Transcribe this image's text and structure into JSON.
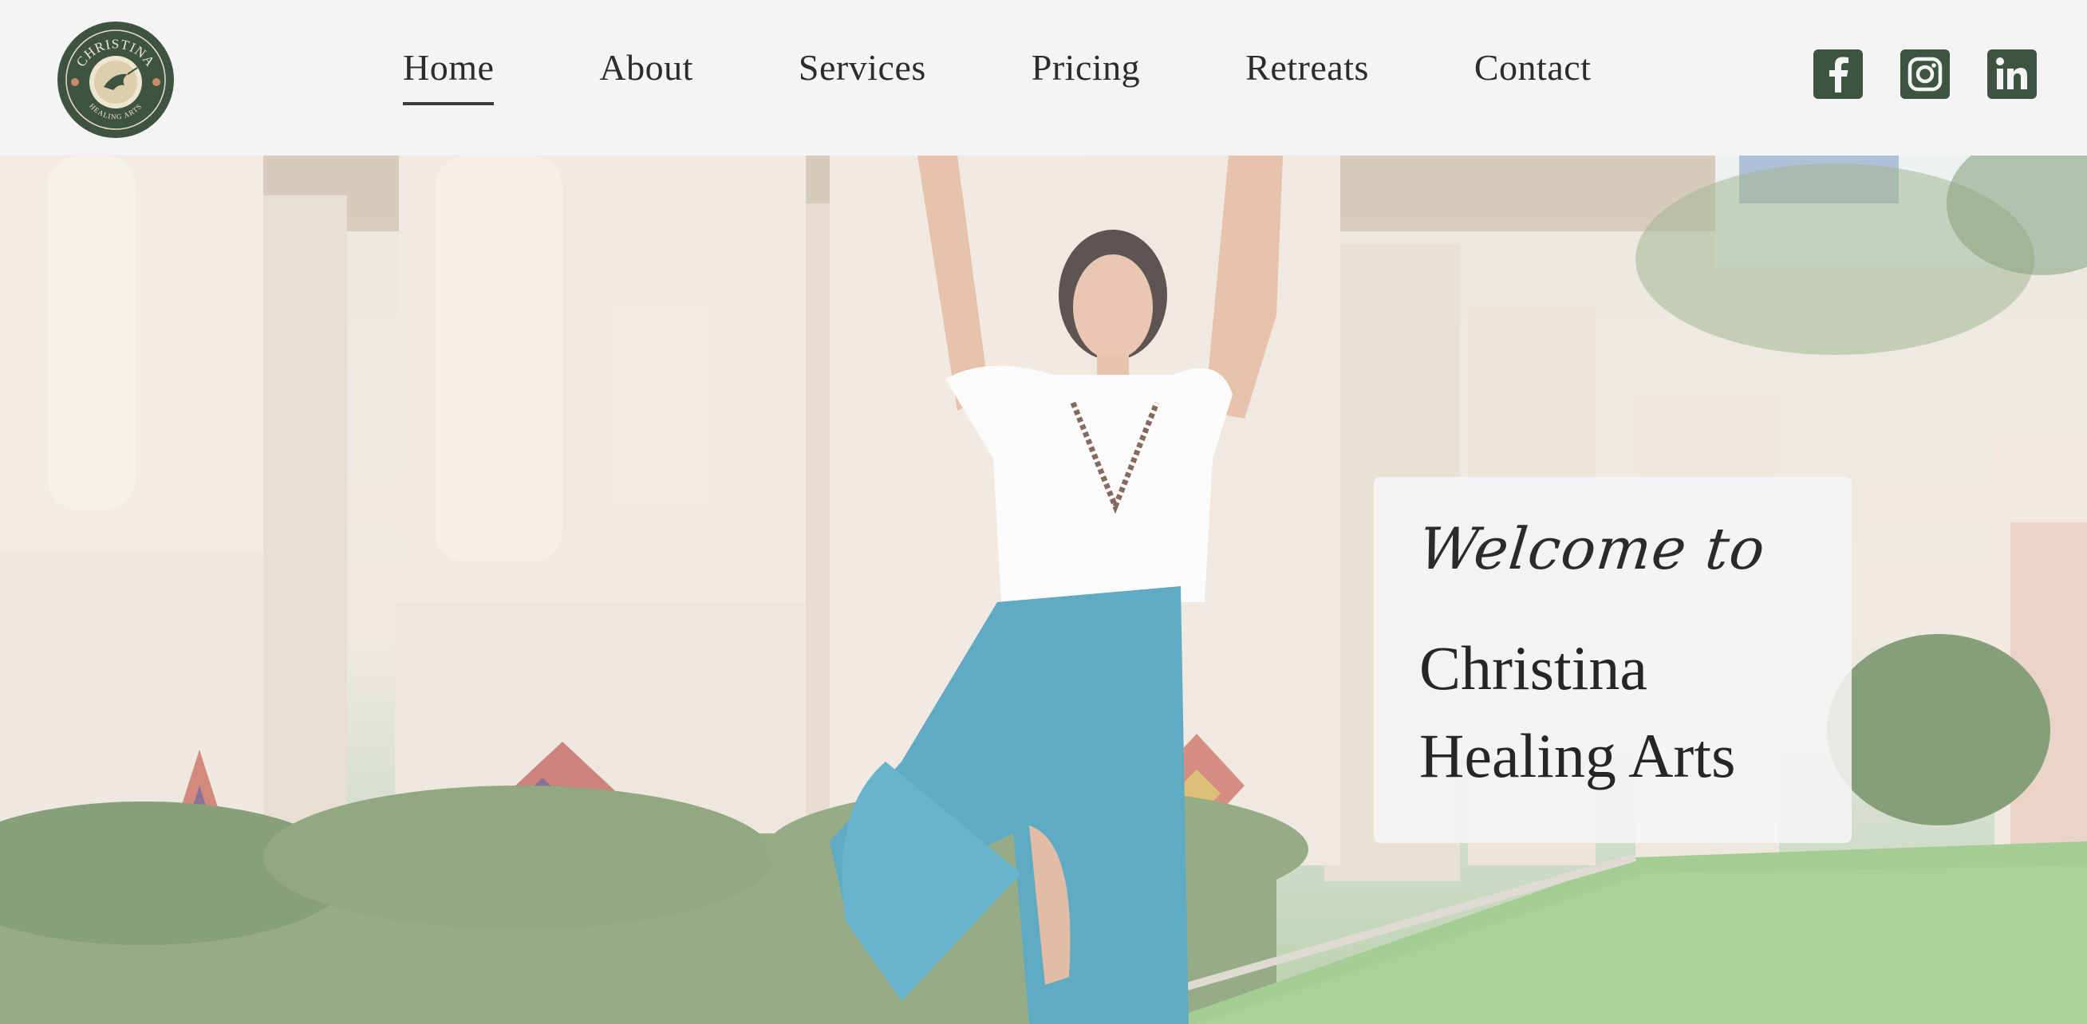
{
  "header": {
    "logo": {
      "top_text": "CHRISTINA",
      "bottom_text": "HEALING ARTS",
      "icon": "hummingbird-seal-icon"
    },
    "nav": [
      {
        "label": "Home",
        "active": true
      },
      {
        "label": "About",
        "active": false
      },
      {
        "label": "Services",
        "active": false
      },
      {
        "label": "Pricing",
        "active": false
      },
      {
        "label": "Retreats",
        "active": false
      },
      {
        "label": "Contact",
        "active": false
      }
    ],
    "social": [
      {
        "icon": "facebook-icon"
      },
      {
        "icon": "instagram-icon"
      },
      {
        "icon": "linkedin-icon"
      }
    ]
  },
  "hero": {
    "welcome_script": "Welcome to",
    "title_line1": "Christina",
    "title_line2": "Healing Arts"
  },
  "colors": {
    "brand_green": "#3f5440",
    "page_bg": "#f4f4f4",
    "text_dark": "#2c2c2c"
  }
}
